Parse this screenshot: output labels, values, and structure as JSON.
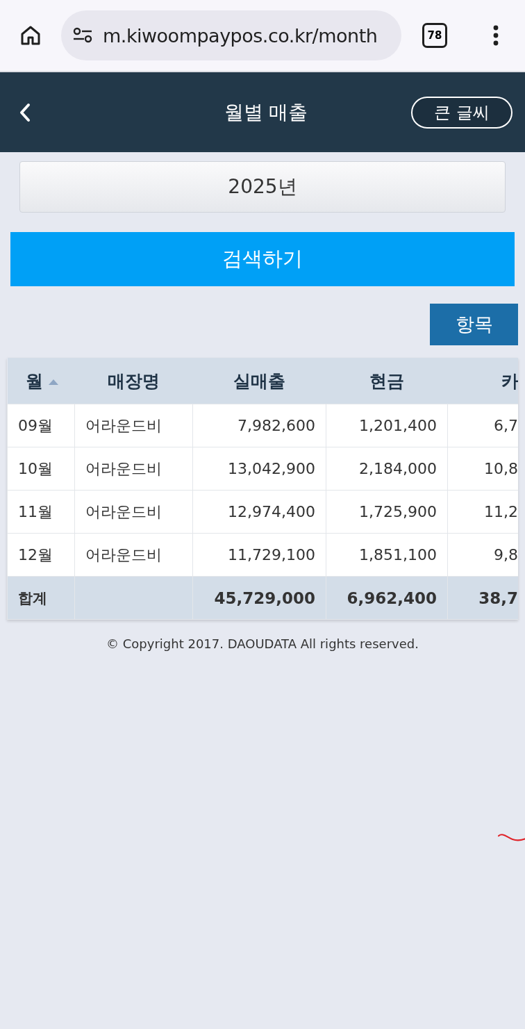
{
  "browser": {
    "url": "m.kiwoompaypos.co.kr/month",
    "tab_count": "78"
  },
  "header": {
    "title": "월별 매출",
    "large_text_button": "큰 글씨"
  },
  "year_select": {
    "value": "2025년"
  },
  "search_button": "검색하기",
  "columns_button": "항목",
  "table": {
    "columns": [
      {
        "label": "월",
        "sorted": true
      },
      {
        "label": "매장명",
        "sorted": false
      },
      {
        "label": "실매출",
        "sorted": false
      },
      {
        "label": "현금",
        "sorted": false
      },
      {
        "label": "카",
        "sorted": false
      }
    ],
    "rows": [
      [
        "09월",
        "어라운드비",
        "7,982,600",
        "1,201,400",
        "6,7"
      ],
      [
        "10월",
        "어라운드비",
        "13,042,900",
        "2,184,000",
        "10,8"
      ],
      [
        "11월",
        "어라운드비",
        "12,974,400",
        "1,725,900",
        "11,2"
      ],
      [
        "12월",
        "어라운드비",
        "11,729,100",
        "1,851,100",
        "9,8"
      ]
    ],
    "total": {
      "label": "합계",
      "values": [
        "45,729,000",
        "6,962,400",
        "38,7"
      ]
    }
  },
  "footer": "© Copyright 2017. DAOUDATA All rights reserved."
}
